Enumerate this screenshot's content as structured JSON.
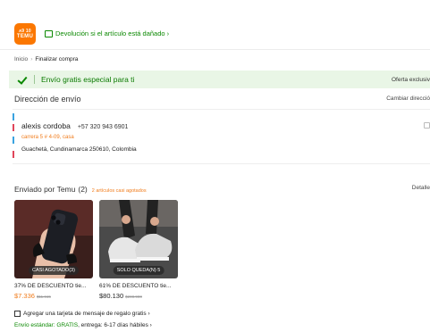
{
  "header": {
    "logo_top": "ᴀ9 10",
    "logo_bottom": "TEMU",
    "return_note": "Devolución si el artículo está dañado ›",
    "colors": {
      "brand": "#fb7701",
      "green": "#0a8800"
    }
  },
  "breadcrumb": {
    "home": "Inicio",
    "separator": "›",
    "current": "Finalizar compra"
  },
  "promo": {
    "text": "Envío gratis especial para ti",
    "right": "Oferta exclusiv"
  },
  "address": {
    "title": "Dirección de envío",
    "change": "Cambiar direcció",
    "name": "alexis cordoba",
    "phone": "+57 320 943 6901",
    "street": "carrera 5 # 4-09, casa",
    "city": "Guachetá, Cundinamarca 250610, Colombia"
  },
  "shipping": {
    "title": "Enviado por Temu",
    "count": "(2)",
    "warning": "2 artículos casi agotados",
    "details": "Detalle"
  },
  "products": [
    {
      "badge": "CASI AGOTADO(3)",
      "name": "37% DE DESCUENTO tie...",
      "price": "$7.336",
      "old_price": "$11.615",
      "price_color": "#f07b1a"
    },
    {
      "badge": "SOLO QUEDA(N) 5",
      "name": "61% DE DESCUENTO tie...",
      "price": "$80.130",
      "old_price": "$208.900",
      "price_color": "#222222"
    }
  ],
  "gift": {
    "text": "Agregar una tarjeta de mensaje de regalo gratis ›"
  },
  "free_shipping": {
    "label": "Envío estándar: GRATIS",
    "rest": ", entrega: 6-17 días hábiles ›"
  }
}
